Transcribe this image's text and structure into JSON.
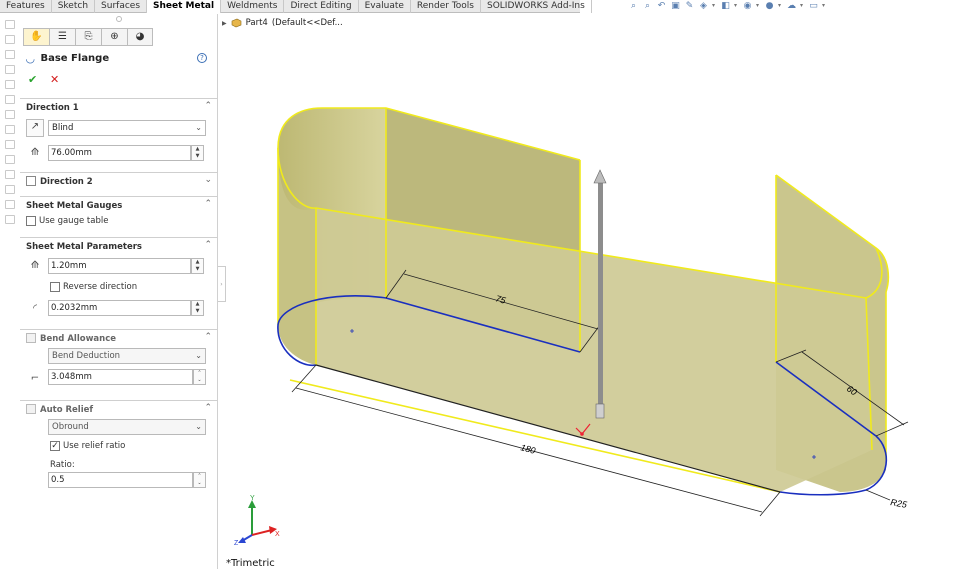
{
  "tabs": [
    "Features",
    "Sketch",
    "Surfaces",
    "Sheet Metal",
    "Weldments",
    "Direct Editing",
    "Evaluate",
    "Render Tools",
    "SOLIDWORKS Add-Ins"
  ],
  "active_tab": "Sheet Metal",
  "pm_tab_icons": [
    "property-manager-icon",
    "feature-tree-icon",
    "config-icon",
    "dimxpert-icon",
    "appearance-icon"
  ],
  "feature": {
    "title": "Base Flange",
    "help": "?",
    "ok": "✔",
    "cancel": "✕"
  },
  "direction1": {
    "label": "Direction 1",
    "end_condition": "Blind",
    "depth": "76.00mm"
  },
  "direction2": {
    "label": "Direction 2"
  },
  "gauges": {
    "label": "Sheet Metal Gauges",
    "use_gauge_table": "Use gauge table"
  },
  "parameters": {
    "label": "Sheet Metal Parameters",
    "thickness": "1.20mm",
    "reverse": "Reverse direction",
    "radius": "0.2032mm"
  },
  "bend_allowance": {
    "label": "Bend Allowance",
    "type": "Bend Deduction",
    "value": "3.048mm"
  },
  "auto_relief": {
    "label": "Auto Relief",
    "type": "Obround",
    "use_ratio": "Use relief ratio",
    "ratio_label": "Ratio:",
    "ratio": "0.5"
  },
  "tree": {
    "part": "Part4",
    "config": "(Default<<Def..."
  },
  "dimensions": {
    "d75": "75",
    "d60": "60",
    "d180": "180",
    "r25": "R25"
  },
  "axes": {
    "x": "X",
    "y": "Y",
    "z": "Z"
  },
  "view_name": "*Trimetric",
  "colors": {
    "face": "#c8c58a",
    "edge_highlight": "#f0ea1c",
    "sketch": "#1a2fbf"
  }
}
